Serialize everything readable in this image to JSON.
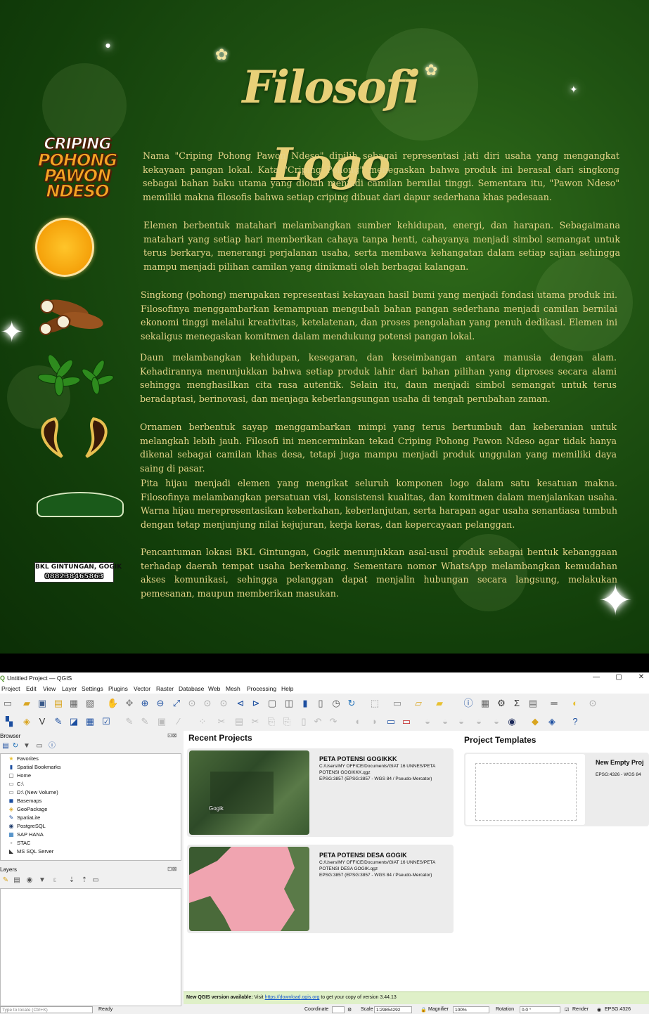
{
  "poster": {
    "title": "Filosofi Logo",
    "logo_lines": [
      "CRIPING",
      "POHONG",
      "PAWON",
      "NDESO"
    ],
    "address_line": "BKL GINTUNGAN, GOGIK",
    "phone": "088238465863",
    "paragraphs": [
      "Nama \"Criping Pohong Pawon Ndeso\" dipilih sebagai representasi jati diri usaha yang mengangkat kekayaan pangan lokal. Kata \"Criping Pohong\" menegaskan bahwa produk ini berasal dari singkong sebagai bahan baku utama yang diolah menjadi camilan bernilai tinggi. Sementara itu, \"Pawon Ndeso\" memiliki makna filosofis bahwa setiap criping dibuat dari dapur sederhana khas pedesaan.",
      "Elemen berbentuk matahari melambangkan sumber kehidupan, energi, dan harapan. Sebagaimana matahari yang setiap hari memberikan cahaya tanpa henti, cahayanya menjadi simbol semangat untuk terus berkarya, menerangi perjalanan usaha, serta membawa kehangatan dalam setiap sajian sehingga mampu menjadi pilihan camilan yang dinikmati oleh berbagai kalangan.",
      "Singkong (pohong) merupakan representasi kekayaan hasil bumi yang menjadi fondasi utama produk ini. Filosofinya menggambarkan kemampuan mengubah bahan pangan sederhana menjadi camilan bernilai ekonomi tinggi melalui kreativitas, ketelatenan, dan proses pengolahan yang penuh dedikasi. Elemen ini sekaligus menegaskan komitmen dalam mendukung potensi pangan lokal.",
      "Daun melambangkan kehidupan, kesegaran, dan keseimbangan antara manusia dengan alam. Kehadirannya menunjukkan bahwa setiap produk lahir dari bahan pilihan yang diproses secara alami sehingga menghasilkan cita rasa autentik. Selain itu, daun menjadi simbol semangat untuk terus beradaptasi, berinovasi, dan menjaga keberlangsungan usaha di tengah perubahan zaman.",
      "Ornamen berbentuk sayap menggambarkan mimpi yang terus bertumbuh dan keberanian untuk melangkah lebih jauh. Filosofi ini mencerminkan tekad Criping Pohong Pawon Ndeso agar tidak hanya dikenal sebagai camilan khas desa, tetapi juga mampu menjadi produk unggulan yang memiliki daya saing di pasar.",
      "Pita hijau menjadi elemen yang mengikat seluruh komponen logo dalam satu kesatuan makna. Filosofinya melambangkan persatuan visi, konsistensi kualitas, dan komitmen dalam menjalankan usaha. Warna hijau merepresentasikan keberkahan, keberlanjutan, serta harapan agar usaha senantiasa tumbuh dengan tetap menjunjung nilai kejujuran, kerja keras, dan kepercayaan pelanggan.",
      "Pencantuman lokasi BKL Gintungan, Gogik menunjukkan asal-usul produk sebagai bentuk kebanggaan terhadap daerah tempat usaha berkembang. Sementara nomor WhatsApp melambangkan kemudahan akses komunikasi, sehingga pelanggan dapat menjalin hubungan secara langsung, melakukan pemesanan, maupun memberikan masukan."
    ]
  },
  "qgis": {
    "window_title": "Untitled Project — QGIS",
    "menu": [
      "Project",
      "Edit",
      "View",
      "Layer",
      "Settings",
      "Plugins",
      "Vector",
      "Raster",
      "Database",
      "Web",
      "Mesh",
      "Processing",
      "Help"
    ],
    "browser_panel": {
      "title": "Browser",
      "items": [
        "Favorites",
        "Spatial Bookmarks",
        "Home",
        "C:\\",
        "D:\\ (New Volume)",
        "Basemaps",
        "GeoPackage",
        "SpatiaLite",
        "PostgreSQL",
        "SAP HANA",
        "STAC",
        "MS SQL Server"
      ]
    },
    "layers_panel": {
      "title": "Layers"
    },
    "recent_projects_title": "Recent Projects",
    "recent_projects": [
      {
        "name": "PETA POTENSI GOGIKKK",
        "path": "C:/Users/MY OFFICE/Documents/GIAT 16 UNNES/PETA POTENSI GOGIKKK.qgz",
        "crs": "EPSG:3857 (EPSG:3857 - WGS 84 / Pseudo-Mercator)",
        "map_label": "Gogik"
      },
      {
        "name": "PETA POTENSI DESA GOGIK",
        "path": "C:/Users/MY OFFICE/Documents/GIAT 16 UNNES/PETA POTENSI DESA GOGIK.qgz",
        "crs": "EPSG:3857 (EPSG:3857 - WGS 84 / Pseudo-Mercator)"
      }
    ],
    "templates_title": "Project Templates",
    "template": {
      "name": "New Empty Proj",
      "crs": "EPSG:4326 - WGS 84"
    },
    "notice": {
      "prefix": "New QGIS version available:",
      "visit": "Visit",
      "link": "https://download.qgis.org",
      "suffix": "to get your copy of version 3.44.13"
    },
    "status": {
      "locate_placeholder": "Type to locate (Ctrl+K)",
      "ready": "Ready",
      "coordinate_label": "Coordinate",
      "scale_label": "Scale",
      "scale_value": "1:29854292",
      "magnifier_label": "Magnifier",
      "magnifier_value": "100%",
      "rotation_label": "Rotation",
      "rotation_value": "0.0 °",
      "render_label": "Render",
      "crs": "EPSG:4326"
    }
  }
}
